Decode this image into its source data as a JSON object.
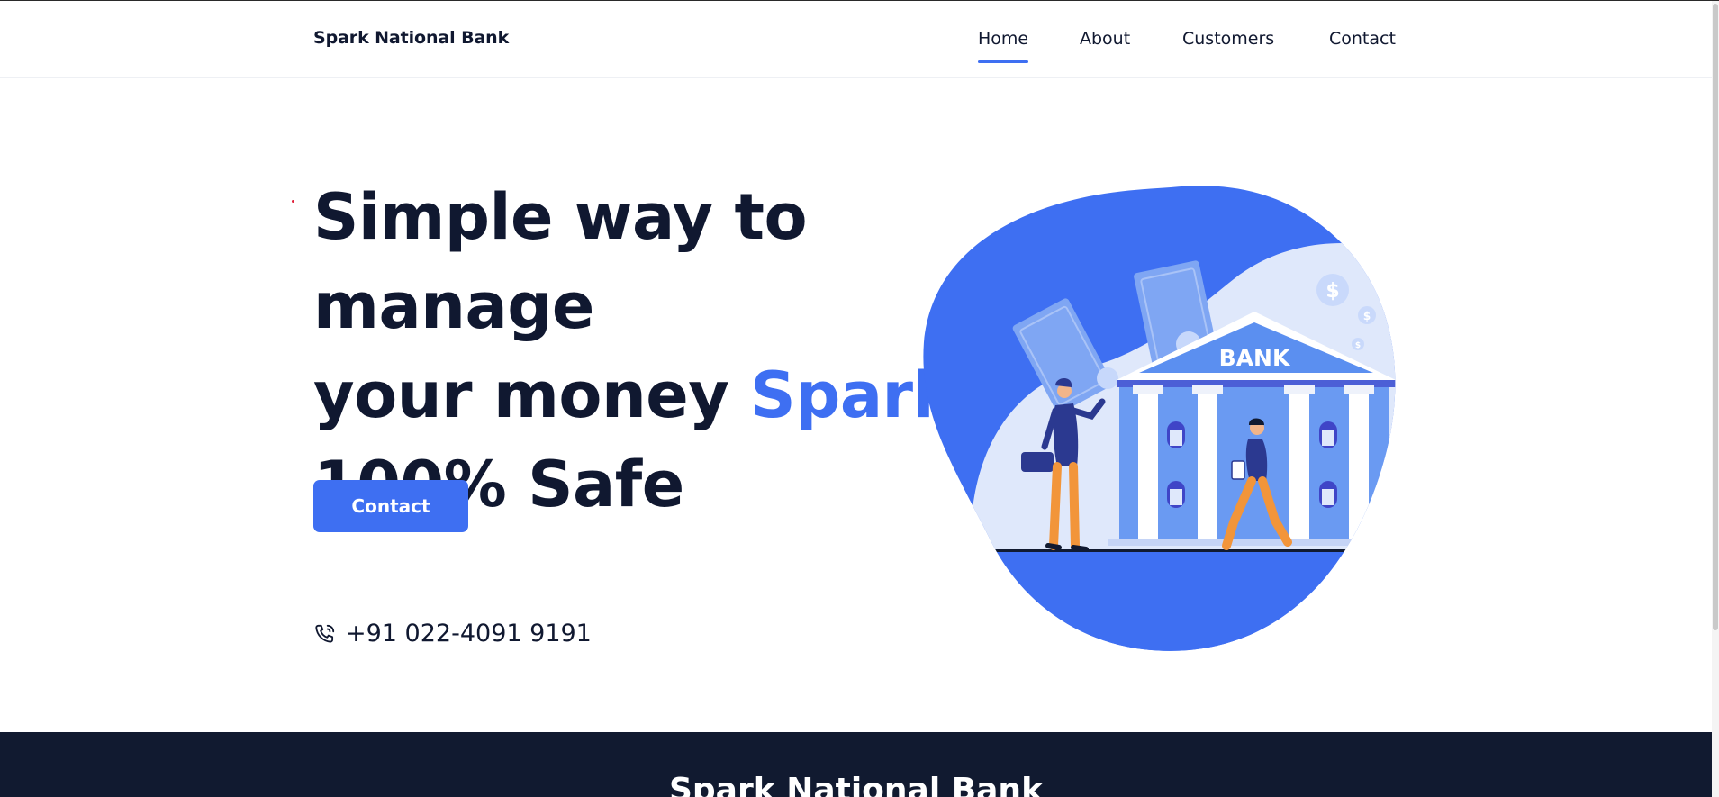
{
  "brand": {
    "name": "Spark National Bank"
  },
  "nav": {
    "items": [
      {
        "label": "Home",
        "active": true
      },
      {
        "label": "About",
        "active": false
      },
      {
        "label": "Customers",
        "active": false
      },
      {
        "label": "Contact",
        "active": false
      }
    ]
  },
  "hero": {
    "line1": "Simple way to manage",
    "line2_prefix": "your money ",
    "line2_accent": "Spark",
    "line3": "100% Safe",
    "button_label": "Contact",
    "phone_icon": "phone-icon",
    "phone_number": "+91 022-4091 9191"
  },
  "illustration": {
    "bank_sign": "BANK",
    "currency_symbol": "$"
  },
  "footer": {
    "title": "Spark National Bank"
  },
  "colors": {
    "accent": "#3e6ff2",
    "text_dark": "#101830",
    "footer_bg": "#111a30",
    "orange": "#f2953a"
  }
}
